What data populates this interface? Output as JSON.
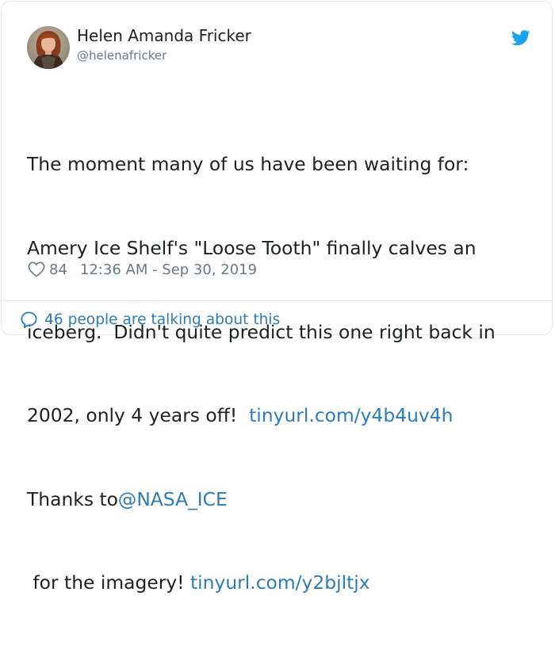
{
  "author": {
    "display_name": "Helen Amanda Fricker",
    "handle": "@helenafricker",
    "avatar_icon": "avatar-photo"
  },
  "brand": {
    "icon": "twitter-bird-icon",
    "color": "#1da1f2"
  },
  "tweet": {
    "line1": "The moment many of us have been waiting for:",
    "line2": "Amery Ice Shelf's \"Loose Tooth\" finally calves an",
    "line3": "iceberg.  Didn't quite predict this one right back in",
    "line4_text": "2002, only 4 years off!  ",
    "link1": "tinyurl.com/y4b4uv4h",
    "line5_text": "Thanks to",
    "mention": "@NASA_ICE",
    "line6_text": " for the imagery! ",
    "link2": "tinyurl.com/y2bjltjx"
  },
  "meta": {
    "likes": "84",
    "timestamp": "12:36 AM - Sep 30, 2019"
  },
  "footer": {
    "conversation_text": "46 people are talking about this"
  },
  "colors": {
    "text": "#1c2022",
    "secondary": "#697882",
    "link": "#2b7bb9",
    "border": "#e1e8ed"
  }
}
